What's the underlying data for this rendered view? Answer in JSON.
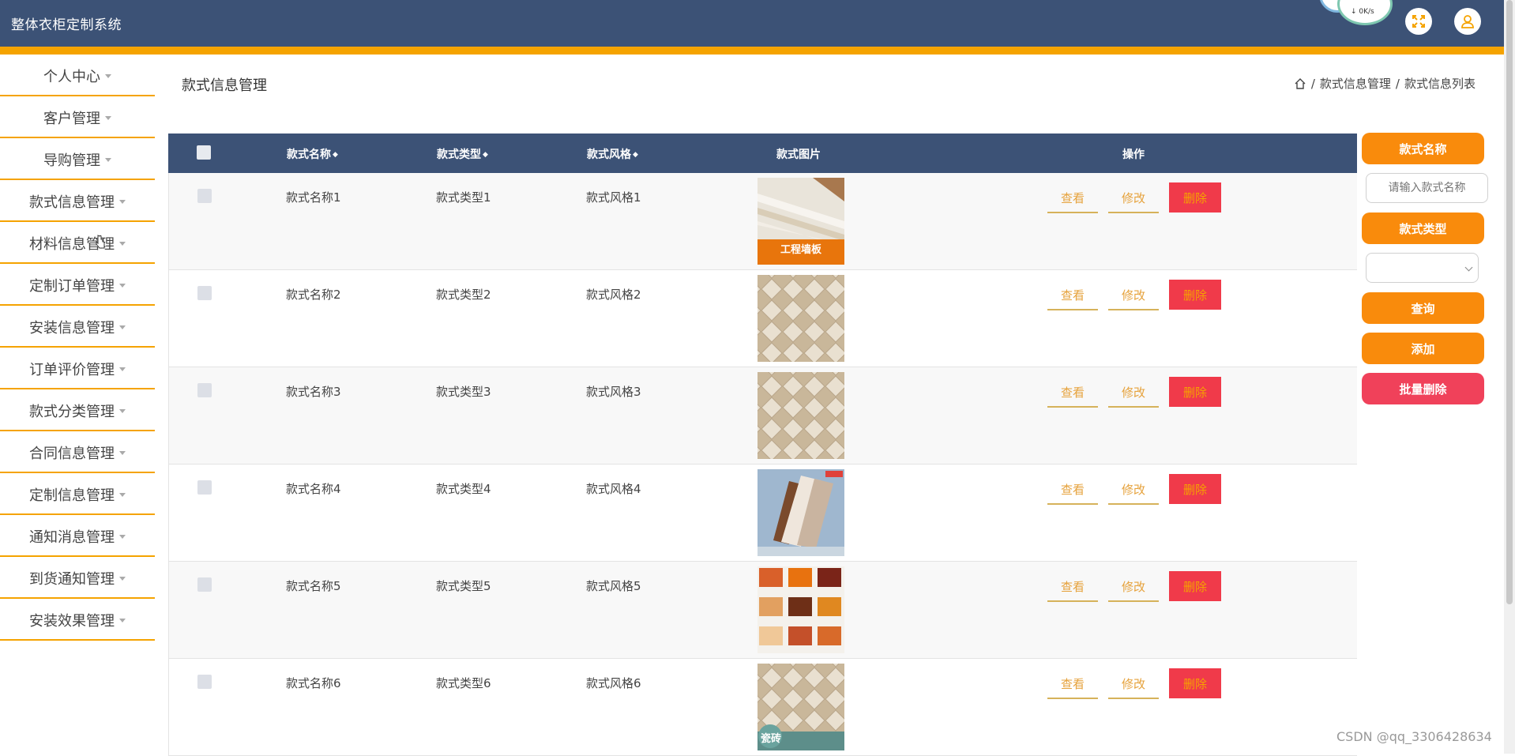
{
  "header": {
    "app_title": "整体衣柜定制系统",
    "speed_label": "↓ 0K/s"
  },
  "sidebar": {
    "items": [
      {
        "label": "个人中心"
      },
      {
        "label": "客户管理"
      },
      {
        "label": "导购管理"
      },
      {
        "label": "款式信息管理"
      },
      {
        "label": "材料信息管理"
      },
      {
        "label": "定制订单管理"
      },
      {
        "label": "安装信息管理"
      },
      {
        "label": "订单评价管理"
      },
      {
        "label": "款式分类管理"
      },
      {
        "label": "合同信息管理"
      },
      {
        "label": "定制信息管理"
      },
      {
        "label": "通知消息管理"
      },
      {
        "label": "到货通知管理"
      },
      {
        "label": "安装效果管理"
      }
    ]
  },
  "page": {
    "title": "款式信息管理",
    "breadcrumb": [
      "款式信息管理",
      "款式信息列表"
    ],
    "breadcrumb_sep": "/"
  },
  "table": {
    "headers": {
      "name": "款式名称",
      "type": "款式类型",
      "style": "款式风格",
      "image": "款式图片",
      "actions": "操作"
    },
    "rows": [
      {
        "name": "款式名称1",
        "type": "款式类型1",
        "style": "款式风格1",
        "image": "wall-panel"
      },
      {
        "name": "款式名称2",
        "type": "款式类型2",
        "style": "款式风格2",
        "image": "diamond-tile"
      },
      {
        "name": "款式名称3",
        "type": "款式类型3",
        "style": "款式风格3",
        "image": "diamond-tile"
      },
      {
        "name": "款式名称4",
        "type": "款式类型4",
        "style": "款式风格4",
        "image": "board-samples"
      },
      {
        "name": "款式名称5",
        "type": "款式类型5",
        "style": "款式风格5",
        "image": "wood-swatches"
      },
      {
        "name": "款式名称6",
        "type": "款式类型6",
        "style": "款式风格6",
        "image": "tile-promo"
      }
    ],
    "actions": {
      "view": "查看",
      "edit": "修改",
      "delete": "删除"
    },
    "image_captions": {
      "wall-panel": "工程墙板",
      "tile-promo": "瓷砖"
    }
  },
  "search": {
    "name_label": "款式名称",
    "name_placeholder": "请输入款式名称",
    "type_label": "款式类型",
    "type_value": "",
    "query_button": "查询",
    "add_button": "添加",
    "batch_delete_button": "批量删除"
  },
  "watermark": "CSDN @qq_3306428634",
  "colors": {
    "header": "#3c5276",
    "accent": "#f5a300",
    "pill": "#f98b0c",
    "danger": "#f0415a"
  }
}
